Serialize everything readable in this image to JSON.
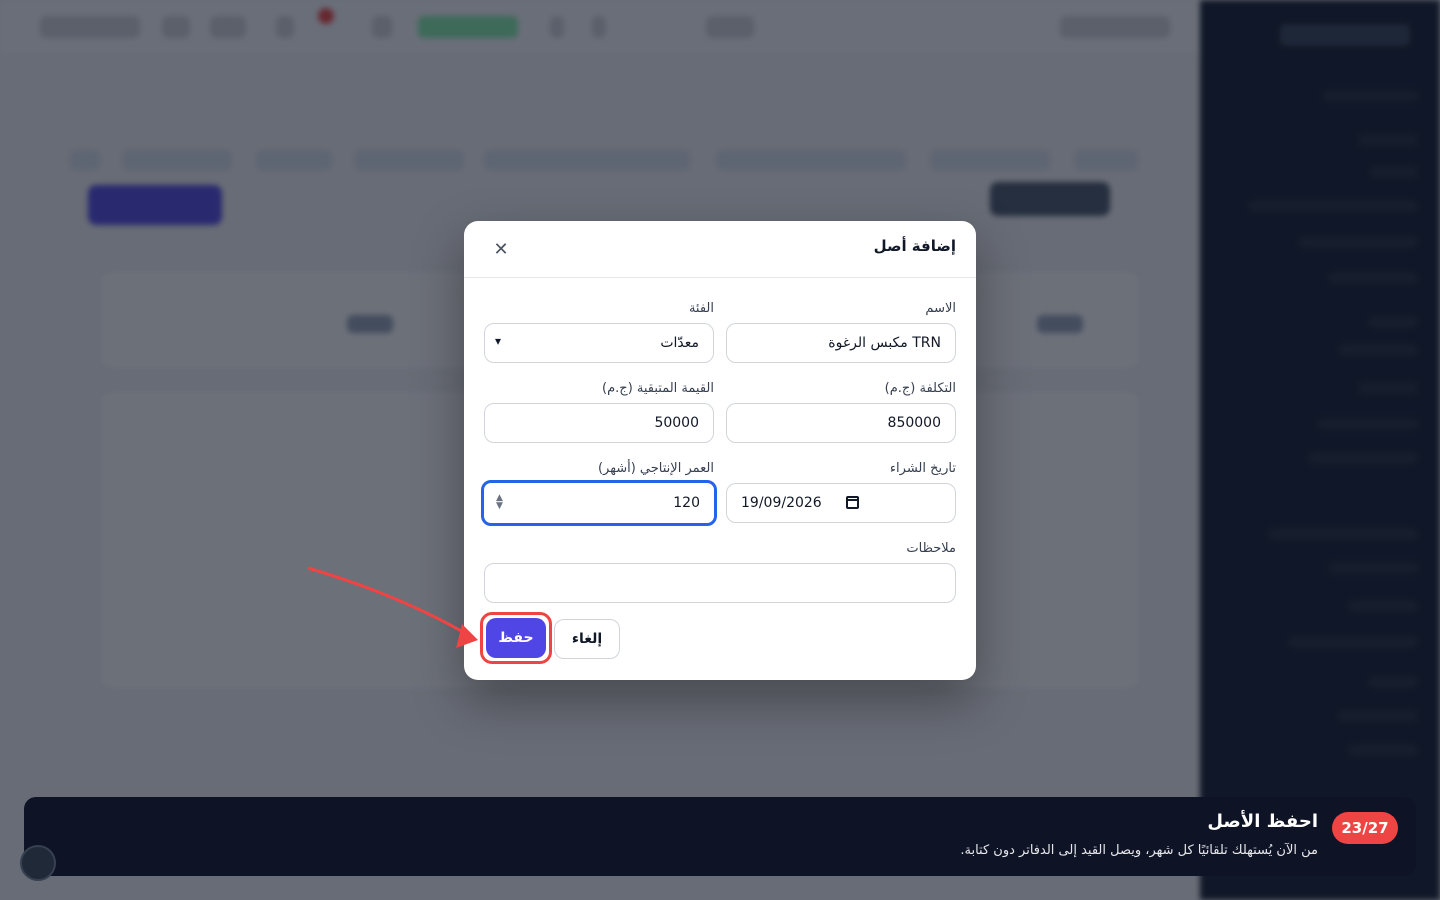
{
  "modal": {
    "title": "إضافة أصل",
    "close_icon": "close-icon",
    "fields": {
      "name": {
        "label": "الاسم",
        "value": "TRN مكبس الرغوة"
      },
      "category": {
        "label": "الفئة",
        "value": "معدّات"
      },
      "cost": {
        "label": "التكلفة (ج.م)",
        "value": "850000"
      },
      "salvage": {
        "label": "القيمة المتبقية (ج.م)",
        "value": "50000"
      },
      "purchase_date": {
        "label": "تاريخ الشراء",
        "value": "19/09/2026"
      },
      "useful_life": {
        "label": "العمر الإنتاجي (أشهر)",
        "value": "120"
      },
      "notes": {
        "label": "ملاحظات",
        "value": ""
      }
    },
    "buttons": {
      "save": "حفظ",
      "cancel": "إلغاء"
    }
  },
  "tour": {
    "counter": "23/27",
    "title": "احفظ الأصل",
    "description": "من الآن يُستهلك تلقائيًا كل شهر، ويصل القيد إلى الدفاتر دون كتابة."
  },
  "colors": {
    "primary": "#4f46e5",
    "highlight": "#ef4444",
    "focus": "#2563eb",
    "banner": "#0f1326"
  }
}
